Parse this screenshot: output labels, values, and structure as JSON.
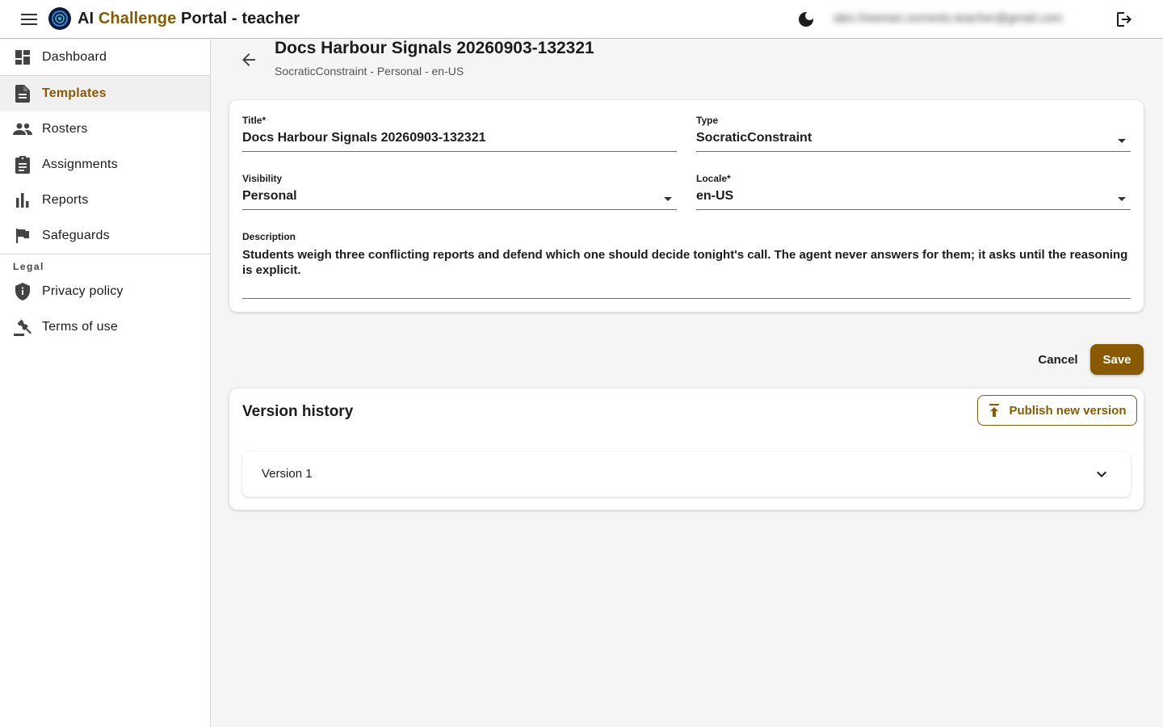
{
  "header": {
    "title_part1": "AI ",
    "title_accent": "Challenge",
    "title_part2": " Portal - teacher",
    "user_email": "alex.freeman.sorrento.teacher@gmail.com",
    "icons": {
      "menu": "menu-icon",
      "logo": "logo-icon",
      "theme": "dark-mode-moon-icon",
      "logout": "logout-icon"
    }
  },
  "sidebar": {
    "items": [
      {
        "label": "Dashboard",
        "icon": "dashboard-icon"
      },
      {
        "label": "Templates",
        "icon": "document-icon"
      },
      {
        "label": "Rosters",
        "icon": "people-icon"
      },
      {
        "label": "Assignments",
        "icon": "clipboard-icon"
      },
      {
        "label": "Reports",
        "icon": "bar-chart-icon"
      },
      {
        "label": "Safeguards",
        "icon": "flag-icon"
      }
    ],
    "active_index": 1,
    "legal_heading": "Legal",
    "legal_items": [
      {
        "label": "Privacy policy",
        "icon": "shield-icon"
      },
      {
        "label": "Terms of use",
        "icon": "gavel-icon"
      }
    ]
  },
  "page": {
    "title": "Docs Harbour Signals 20260903-132321",
    "subtitle": "SocraticConstraint - Personal - en-US"
  },
  "form": {
    "title_label": "Title*",
    "title_value": "Docs Harbour Signals 20260903-132321",
    "type_label": "Type",
    "type_value": "SocraticConstraint",
    "visibility_label": "Visibility",
    "visibility_value": "Personal",
    "locale_label": "Locale*",
    "locale_value": "en-US",
    "description_label": "Description",
    "description_value": "Students weigh three conflicting reports and defend which one should decide tonight's call. The agent never answers for them; it asks until the reasoning is explicit."
  },
  "actions": {
    "cancel_label": "Cancel",
    "save_label": "Save"
  },
  "versions": {
    "heading": "Version history",
    "publish_label": "Publish new version",
    "items": [
      {
        "label": "Version 1"
      }
    ]
  },
  "colors": {
    "accent": "#8a5a00",
    "background": "#f5f5f5",
    "surface": "#ffffff"
  }
}
